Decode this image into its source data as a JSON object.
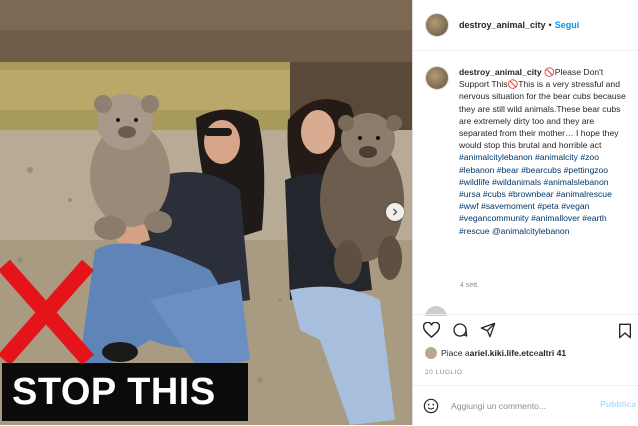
{
  "post": {
    "banner_text": "STOP THIS",
    "next_icon": "chevron-right-icon"
  },
  "header": {
    "username": "destroy_animal_city",
    "separator": "•",
    "follow_label": "Segui"
  },
  "caption": {
    "username": "destroy_animal_city",
    "text": "🚫Please Don't Support This🚫This is a very stressful and nervous situation for the bear cubs because they are still wild animals.These bear cubs are extremely dirty too and they are separated from their mother… I hope they would stop this brutal and horrible act",
    "hashtags": "#animalcitylebanon #animalcity #zoo #lebanon #bear #bearcubs #pettingzoo #wildlife #wildanimals #animalslebanon #ursa #cubs #brownbear #animalrescue #wwf #savemoment #peta #vegan #vegancommunity #animallover #earth #rescue @animalcitylebanon",
    "time": "4 sett."
  },
  "actions": {
    "like_icon": "heart-icon",
    "comment_icon": "comment-icon",
    "share_icon": "share-icon",
    "save_icon": "bookmark-icon"
  },
  "likes": {
    "prefix": "Piace a ",
    "user": "ariel.kiki.life.etc",
    "middle": " e ",
    "others": "altri 41"
  },
  "date": "20 LUGLIO",
  "comment_box": {
    "emoji_icon": "emoji-icon",
    "placeholder": "Aggiungi un commento...",
    "publish_label": "Pubblica"
  },
  "colors": {
    "link": "#00376b",
    "follow": "#0095f6",
    "publish_disabled": "#b2dffc",
    "x_mark": "#e5141b"
  }
}
